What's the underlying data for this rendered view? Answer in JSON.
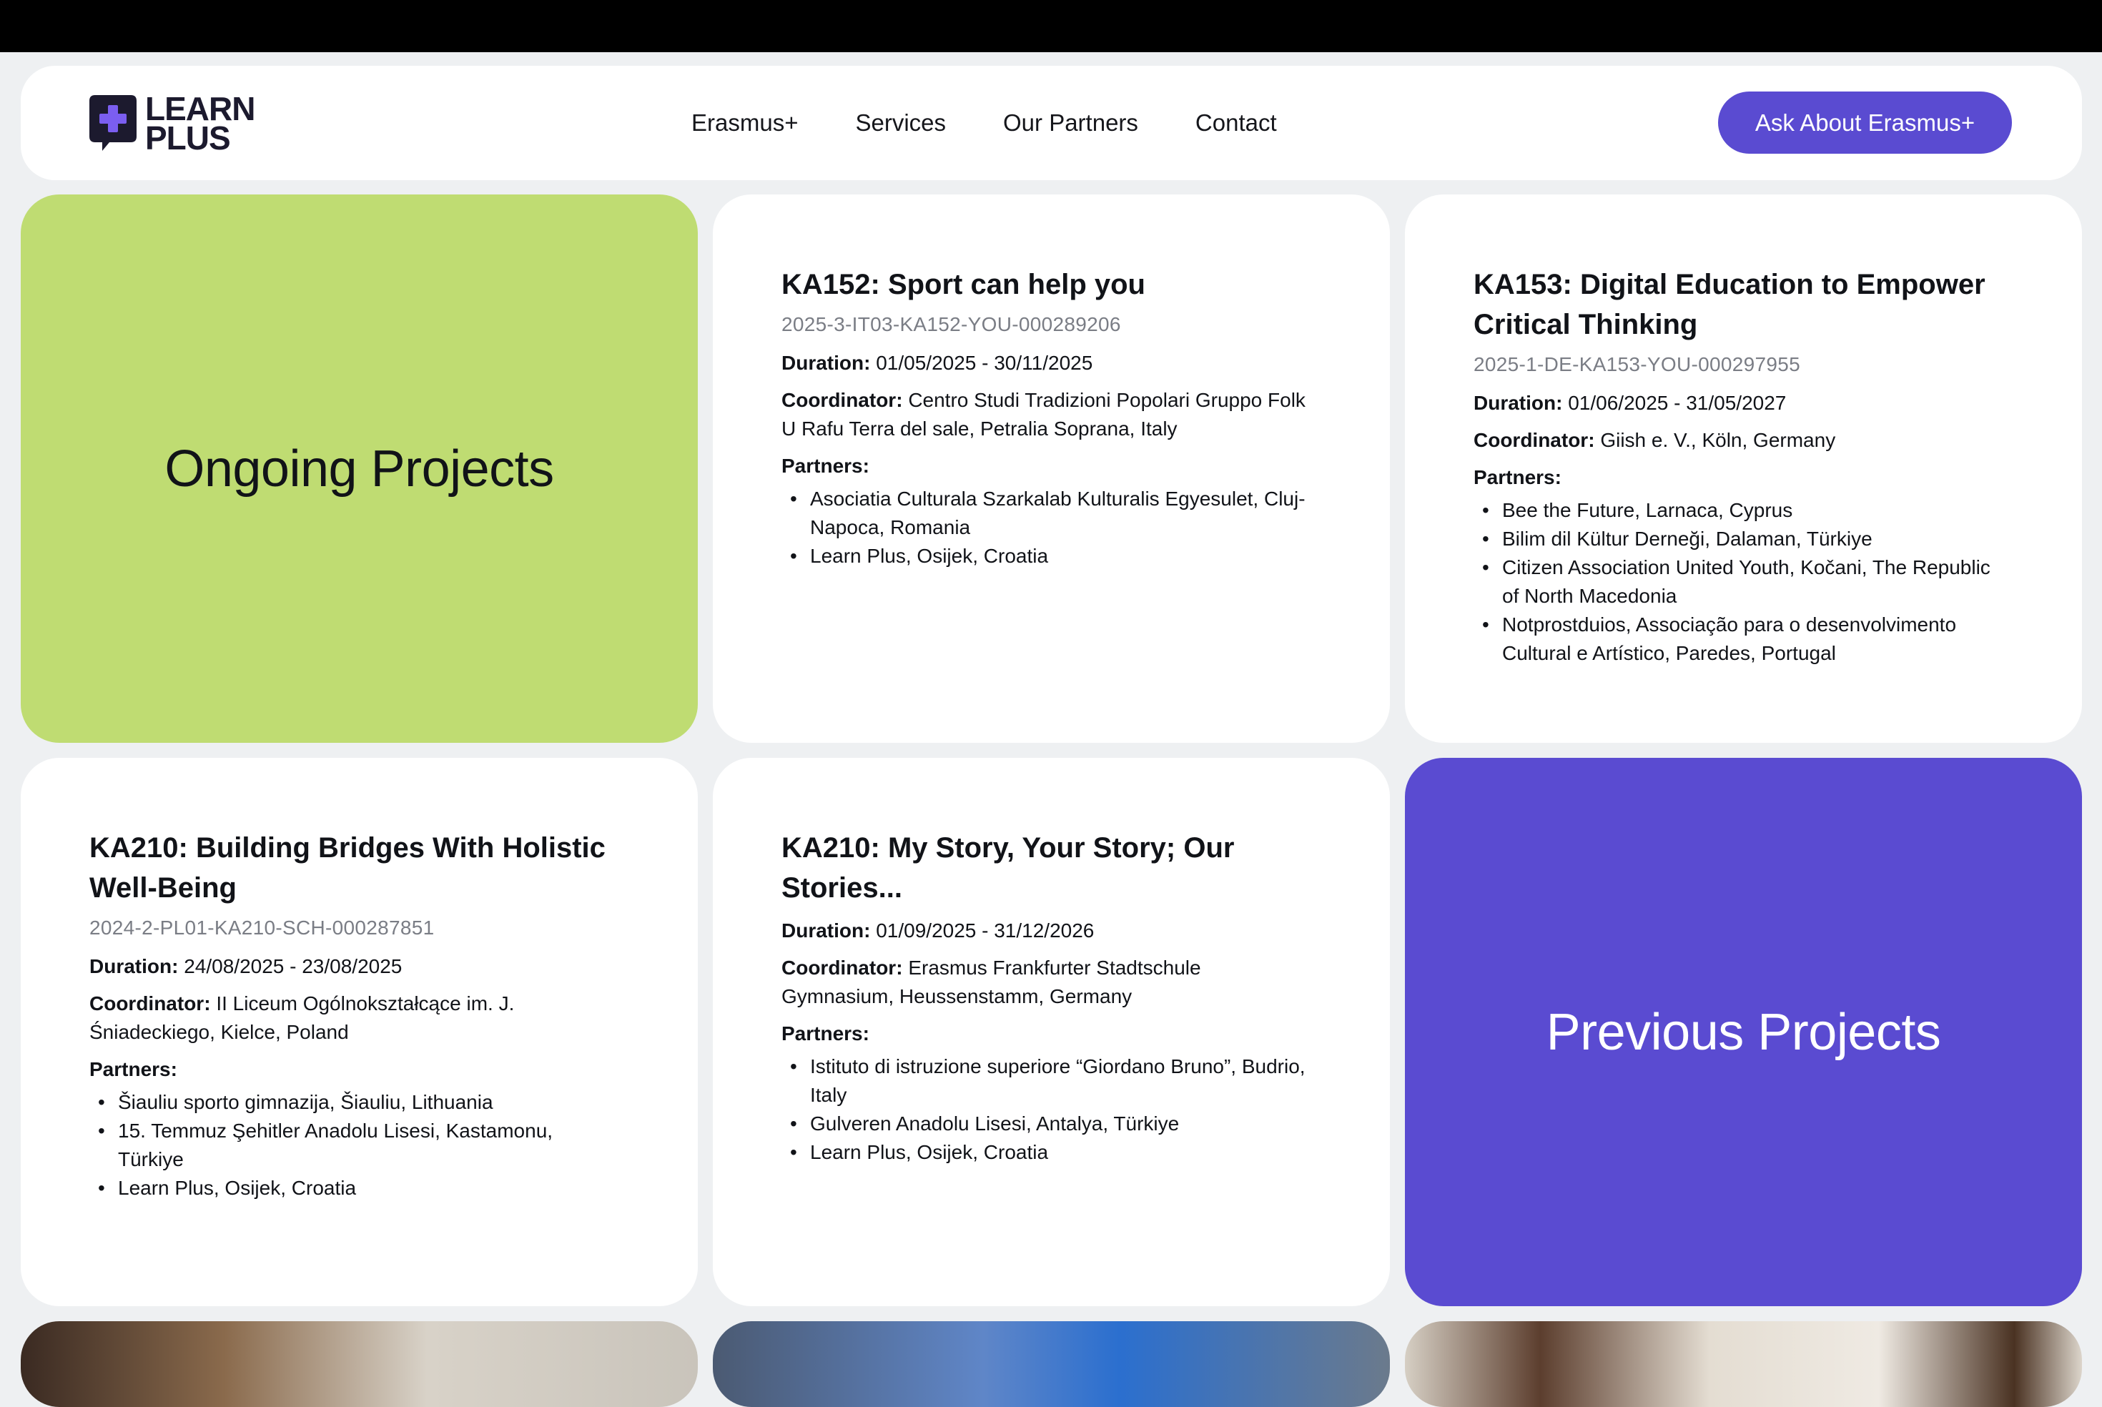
{
  "brand": {
    "line1": "LEARN",
    "line2": "PLUS",
    "accent": "#5a4bd1",
    "dark": "#1c1a2e"
  },
  "nav": {
    "links": [
      "Erasmus+",
      "Services",
      "Our Partners",
      "Contact"
    ],
    "cta": "Ask About Erasmus+"
  },
  "tiles": {
    "ongoing": "Ongoing Projects",
    "previous": "Previous Projects",
    "ongoing_color": "#bfdc72",
    "previous_color": "#5a4bd1"
  },
  "labels": {
    "duration": "Duration:",
    "coordinator": "Coordinator:",
    "partners": "Partners:"
  },
  "projects": [
    {
      "title": "KA152: Sport can help you",
      "code": "2025-3-IT03-KA152-YOU-000289206",
      "duration": "01/05/2025 - 30/11/2025",
      "coordinator": "Centro Studi Tradizioni Popolari Gruppo Folk U Rafu Terra del sale, Petralia Soprana, Italy",
      "partners": [
        "Asociatia Culturala Szarkalab Kulturalis Egyesulet, Cluj-Napoca, Romania",
        "Learn Plus, Osijek, Croatia"
      ]
    },
    {
      "title": "KA153: Digital Education to Empower Critical Thinking",
      "code": "2025-1-DE-KA153-YOU-000297955",
      "duration": "01/06/2025 - 31/05/2027",
      "coordinator": "Giish e. V., Köln, Germany",
      "partners": [
        "Bee the Future, Larnaca, Cyprus",
        "Bilim dil Kültur Derneği, Dalaman, Türkiye",
        "Citizen Association United Youth, Kočani, The Republic of North Macedonia",
        "Notprostduios, Associação para o desenvolvimento Cultural e Artístico, Paredes, Portugal"
      ]
    },
    {
      "title": "KA210: Building Bridges With Holistic Well-Being",
      "code": "2024-2-PL01-KA210-SCH-000287851",
      "duration": "24/08/2025 - 23/08/2025",
      "coordinator": "II Liceum Ogólnokształcące im. J. Śniadeckiego, Kielce, Poland",
      "partners": [
        "Šiauliu sporto gimnazija, Šiauliu, Lithuania",
        "15. Temmuz Şehitler Anadolu Lisesi, Kastamonu, Türkiye",
        "Learn Plus, Osijek, Croatia"
      ]
    },
    {
      "title": "KA210: My Story, Your Story; Our Stories...",
      "code": "",
      "duration": "01/09/2025 - 31/12/2026",
      "coordinator": "Erasmus Frankfurter Stadtschule Gymnasium, Heussenstamm, Germany",
      "partners": [
        "Istituto di istruzione superiore “Giordano Bruno”, Budrio, Italy",
        "Gulveren Anadolu Lisesi, Antalya, Türkiye",
        "Learn Plus, Osijek, Croatia"
      ]
    }
  ]
}
